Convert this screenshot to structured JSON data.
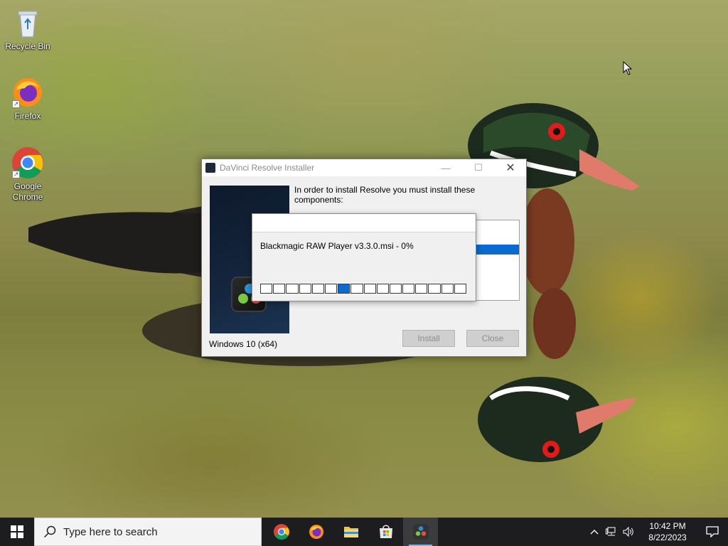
{
  "desktop": {
    "icons": [
      {
        "label": "Recycle Bin",
        "icon": "recycle-bin-icon"
      },
      {
        "label": "Firefox",
        "icon": "firefox-icon"
      },
      {
        "label": "Google Chrome",
        "icon": "chrome-icon"
      }
    ]
  },
  "installer": {
    "title": "DaVinci Resolve Installer",
    "instruction": "In order to install Resolve you must install these components:",
    "os_label": "Windows 10 (x64)",
    "install_label": "Install",
    "close_label": "Close",
    "minimize_glyph": "—",
    "maximize_glyph": "☐",
    "close_glyph": "✕"
  },
  "progress_dialog": {
    "file_status": "Blackmagic RAW Player v3.3.0.msi - 0%",
    "active_block_index": 6,
    "block_count": 16
  },
  "taskbar": {
    "search_placeholder": "Type here to search",
    "apps": [
      {
        "name": "chrome",
        "icon": "chrome-icon"
      },
      {
        "name": "firefox",
        "icon": "firefox-icon"
      },
      {
        "name": "file-explorer",
        "icon": "folder-icon"
      },
      {
        "name": "microsoft-store",
        "icon": "store-icon"
      },
      {
        "name": "davinci-resolve-installer",
        "icon": "davinci-resolve-icon",
        "active": true
      }
    ],
    "time": "10:42 PM",
    "date": "8/22/2023"
  },
  "colors": {
    "accent": "#0a6ad0",
    "taskbar": "#1d1d1f"
  }
}
